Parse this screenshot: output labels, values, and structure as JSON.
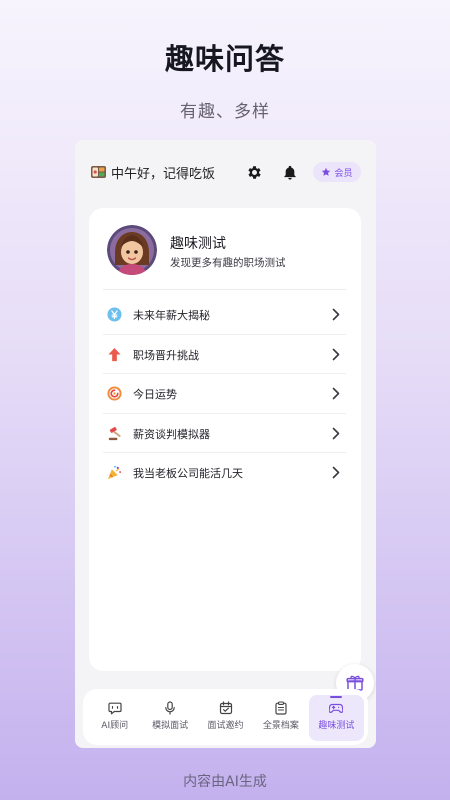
{
  "hero": {
    "title": "趣味问答",
    "subtitle": "有趣、多样"
  },
  "topbar": {
    "greeting": "中午好，记得吃饭",
    "greeting_icon": "meal-icon",
    "vip_label": "会员",
    "settings_icon": "gear-icon",
    "bell_icon": "bell-icon"
  },
  "card": {
    "title": "趣味测试",
    "description": "发现更多有趣的职场测试",
    "items": [
      {
        "label": "未来年薪大揭秘",
        "icon": "yuan-coin-icon"
      },
      {
        "label": "职场晋升挑战",
        "icon": "arrow-up-icon"
      },
      {
        "label": "今日运势",
        "icon": "fortune-icon"
      },
      {
        "label": "薪资谈判模拟器",
        "icon": "gavel-icon"
      },
      {
        "label": "我当老板公司能活几天",
        "icon": "party-icon"
      }
    ]
  },
  "tabs": [
    {
      "label": "AI顾问",
      "icon": "chat-icon",
      "active": false
    },
    {
      "label": "模拟面试",
      "icon": "microphone-icon",
      "active": false
    },
    {
      "label": "面试邀约",
      "icon": "calendar-icon",
      "active": false
    },
    {
      "label": "全景档案",
      "icon": "clipboard-icon",
      "active": false
    },
    {
      "label": "趣味测试",
      "icon": "gamepad-icon",
      "active": true
    }
  ],
  "footer": {
    "note": "内容由AI生成"
  },
  "colors": {
    "accent": "#7a4fe0",
    "accent_bg": "#ece7fb"
  }
}
